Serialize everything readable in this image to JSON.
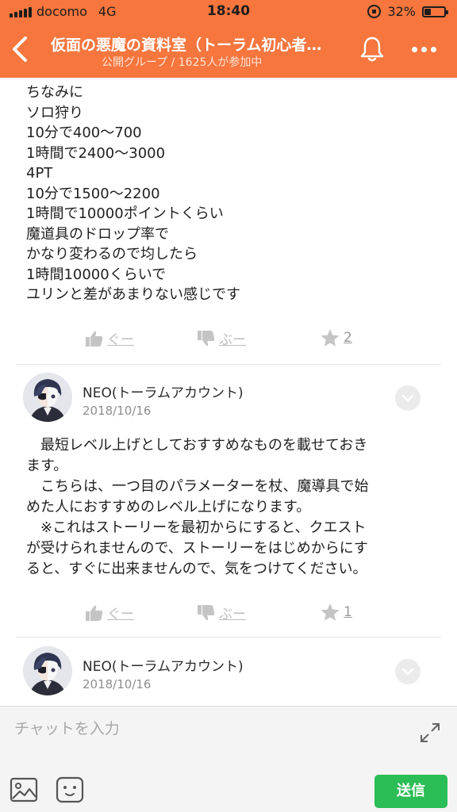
{
  "status_bar": {
    "carrier": "docomo",
    "network": "4G",
    "time": "18:40",
    "battery_percent": "32%",
    "battery_level": 0.32
  },
  "header": {
    "title": "仮面の悪魔の資料室（トーラム初心者…",
    "subtitle": "公開グループ / 1625人が参加中",
    "back_icon": "chevron-left-icon",
    "bell_icon": "bell-icon",
    "more_icon": "more-dots-icon"
  },
  "posts": [
    {
      "lines": [
        "ちなみに",
        "ソロ狩り",
        "10分で400〜700",
        "1時間で2400〜3000",
        "4PT",
        "10分で1500〜2200",
        "1時間で10000ポイントくらい",
        "魔道具のドロップ率で",
        "かなり変わるので均したら",
        "1時間10000くらいで",
        "ユリンと差があまりない感じです"
      ],
      "good_label": "ぐー",
      "bad_label": "ぶー",
      "star_count": "2"
    },
    {
      "author": "NEO(トーラムアカウント)",
      "date": "2018/10/16",
      "lines": [
        "　最短レベル上げとしておすすめなものを載せておき",
        "ます。",
        "　こちらは、一つ目のパラメーターを杖、魔導具で始",
        "めた人におすすめのレベル上げになります。",
        "　※これはストーリーを最初からにすると、クエスト",
        "が受けられませんので、ストーリーをはじめからにす",
        "ると、すぐに出来ませんので、気をつけてください。"
      ],
      "good_label": "ぐー",
      "bad_label": "ぶー",
      "star_count": "1"
    },
    {
      "author": "NEO(トーラムアカウント)",
      "date": "2018/10/16"
    }
  ],
  "input_bar": {
    "placeholder": "チャットを入力",
    "send_label": "送信"
  },
  "colors": {
    "header_bg": "#f6763e",
    "send_button": "#2bbd56",
    "action_gray": "#bdbdbd"
  }
}
